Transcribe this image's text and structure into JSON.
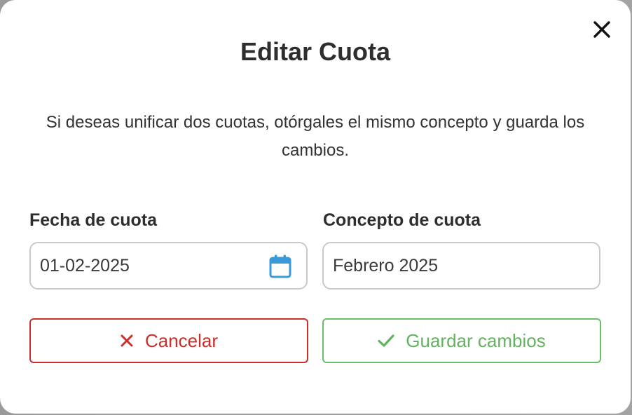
{
  "dialog": {
    "title": "Editar Cuota",
    "description": "Si deseas unificar dos cuotas, otórgales el mismo concepto y guarda los cambios.",
    "close_icon": "close-icon"
  },
  "form": {
    "fecha": {
      "label": "Fecha de cuota",
      "value": "01-02-2025",
      "icon": "calendar-icon"
    },
    "concepto": {
      "label": "Concepto de cuota",
      "value": "Febrero 2025"
    }
  },
  "actions": {
    "cancel": {
      "label": "Cancelar",
      "icon": "x-icon",
      "color": "#c9302c"
    },
    "save": {
      "label": "Guardar cambios",
      "icon": "check-icon",
      "color": "#62b25f"
    }
  },
  "colors": {
    "calendar_icon": "#3a9ad9",
    "title_text": "#2e2e2e"
  }
}
